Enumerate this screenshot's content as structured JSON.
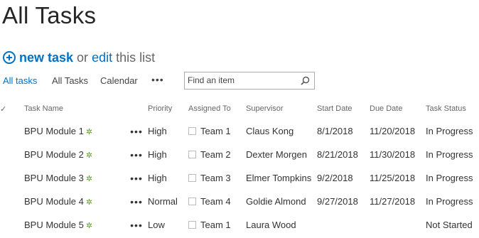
{
  "page": {
    "title": "All Tasks"
  },
  "commands": {
    "new_task": "new task",
    "or": "or",
    "edit": "edit",
    "this_list": "this list"
  },
  "views": {
    "items": [
      "All tasks",
      "All Tasks",
      "Calendar"
    ],
    "more": "•••"
  },
  "search": {
    "placeholder": "Find an item"
  },
  "table": {
    "check_header": "✓",
    "columns": {
      "title": "Task Name",
      "priority": "Priority",
      "assigned": "Assigned To",
      "supervisor": "Supervisor",
      "start": "Start Date",
      "due": "Due Date",
      "status": "Task Status"
    },
    "rows": [
      {
        "title": "BPU Module 1",
        "priority": "High",
        "assigned": "Team 1",
        "supervisor": "Claus Kong",
        "start": "8/1/2018",
        "due": "11/20/2018",
        "status": "In Progress"
      },
      {
        "title": "BPU Module 2",
        "priority": "High",
        "assigned": "Team 2",
        "supervisor": "Dexter Morgen",
        "start": "8/21/2018",
        "due": "11/30/2018",
        "status": "In Progress"
      },
      {
        "title": "BPU Module 3",
        "priority": "High",
        "assigned": "Team 3",
        "supervisor": "Elmer Tompkins",
        "start": "9/2/2018",
        "due": "11/25/2018",
        "status": "In Progress"
      },
      {
        "title": "BPU Module 4",
        "priority": "Normal",
        "assigned": "Team 4",
        "supervisor": "Goldie Almond",
        "start": "9/27/2018",
        "due": "11/27/2018",
        "status": "In Progress"
      },
      {
        "title": "BPU Module 5",
        "priority": "Low",
        "assigned": "Team 1",
        "supervisor": "Laura Wood",
        "start": "",
        "due": "",
        "status": "Not Started"
      }
    ],
    "row_menu": "•••",
    "new_marker": "✲"
  },
  "colors": {
    "accent": "#0072c6",
    "new_marker": "#5a9e1b",
    "text": "#333333",
    "header": "#666666"
  },
  "icons": {
    "add": "plus-circle-icon",
    "search": "magnifier-icon",
    "new": "new-item-icon",
    "checkbox": "checkbox-icon"
  }
}
